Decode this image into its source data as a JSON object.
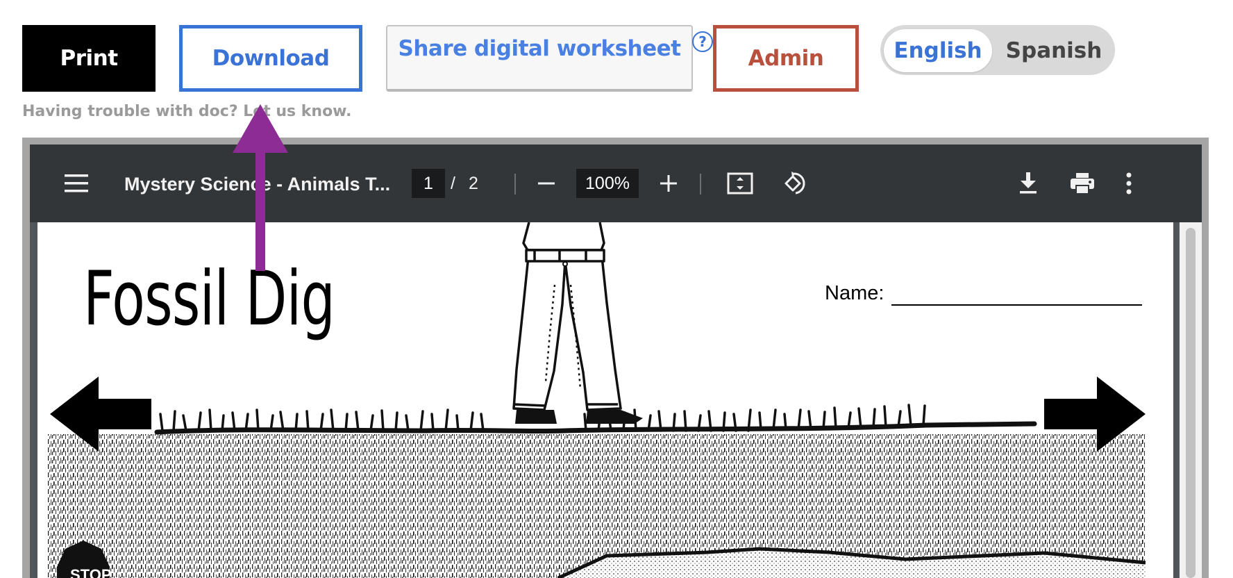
{
  "toolbar_buttons": {
    "print": "Print",
    "download": "Download",
    "share": "Share digital worksheet",
    "help": "?",
    "admin": "Admin"
  },
  "language": {
    "options": [
      "English",
      "Spanish"
    ],
    "selected": "English"
  },
  "help_text": "Having trouble with doc? Let us know.",
  "pdf_viewer": {
    "title": "Mystery Science - Animals T...",
    "page_current": "1",
    "page_separator": "/",
    "page_total": "2",
    "zoom": "100%"
  },
  "worksheet": {
    "title": "Fossil Dig",
    "name_label": "Name:",
    "stop_label": "STOP"
  },
  "colors": {
    "download_blue": "#3a72d6",
    "admin_red": "#b9503d",
    "annotation_arrow": "#8e2c95",
    "viewer_toolbar": "#323639"
  },
  "icons": [
    "hamburger-menu-icon",
    "minus-icon",
    "plus-icon",
    "fit-page-icon",
    "rotate-icon",
    "download-icon",
    "printer-icon",
    "more-options-icon",
    "arrow-left-icon",
    "arrow-right-icon",
    "annotation-up-arrow-icon"
  ]
}
